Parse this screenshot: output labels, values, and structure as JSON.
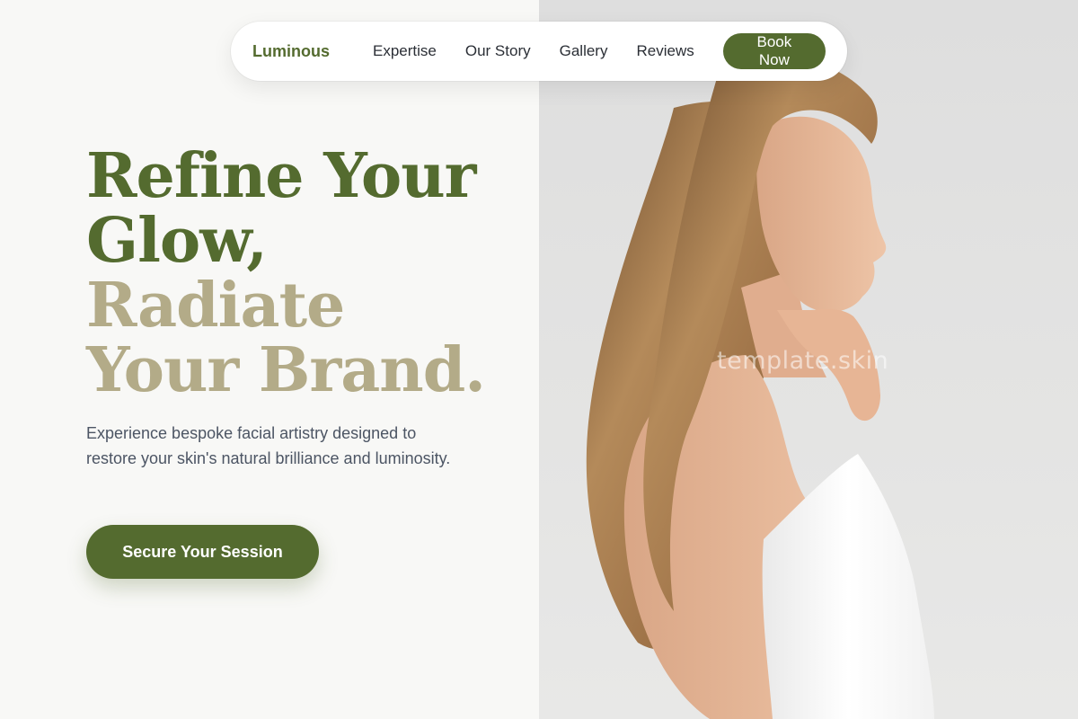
{
  "nav": {
    "brand": "Luminous",
    "links": [
      "Expertise",
      "Our Story",
      "Gallery",
      "Reviews"
    ],
    "cta_label": "Book Now"
  },
  "hero": {
    "headline_line1": "Refine Your",
    "headline_line2": "Glow,",
    "headline_line3": "Radiate",
    "headline_line4": "Your Brand.",
    "subtext": "Experience bespoke facial artistry designed to restore your skin's natural brilliance and luminosity.",
    "cta_label": "Secure Your Session"
  },
  "image": {
    "watermark": "template.skin"
  },
  "colors": {
    "accent": "#546b2f",
    "accent_light": "#b3ab88",
    "background": "#f8f8f6",
    "text_body": "#4c5564"
  }
}
